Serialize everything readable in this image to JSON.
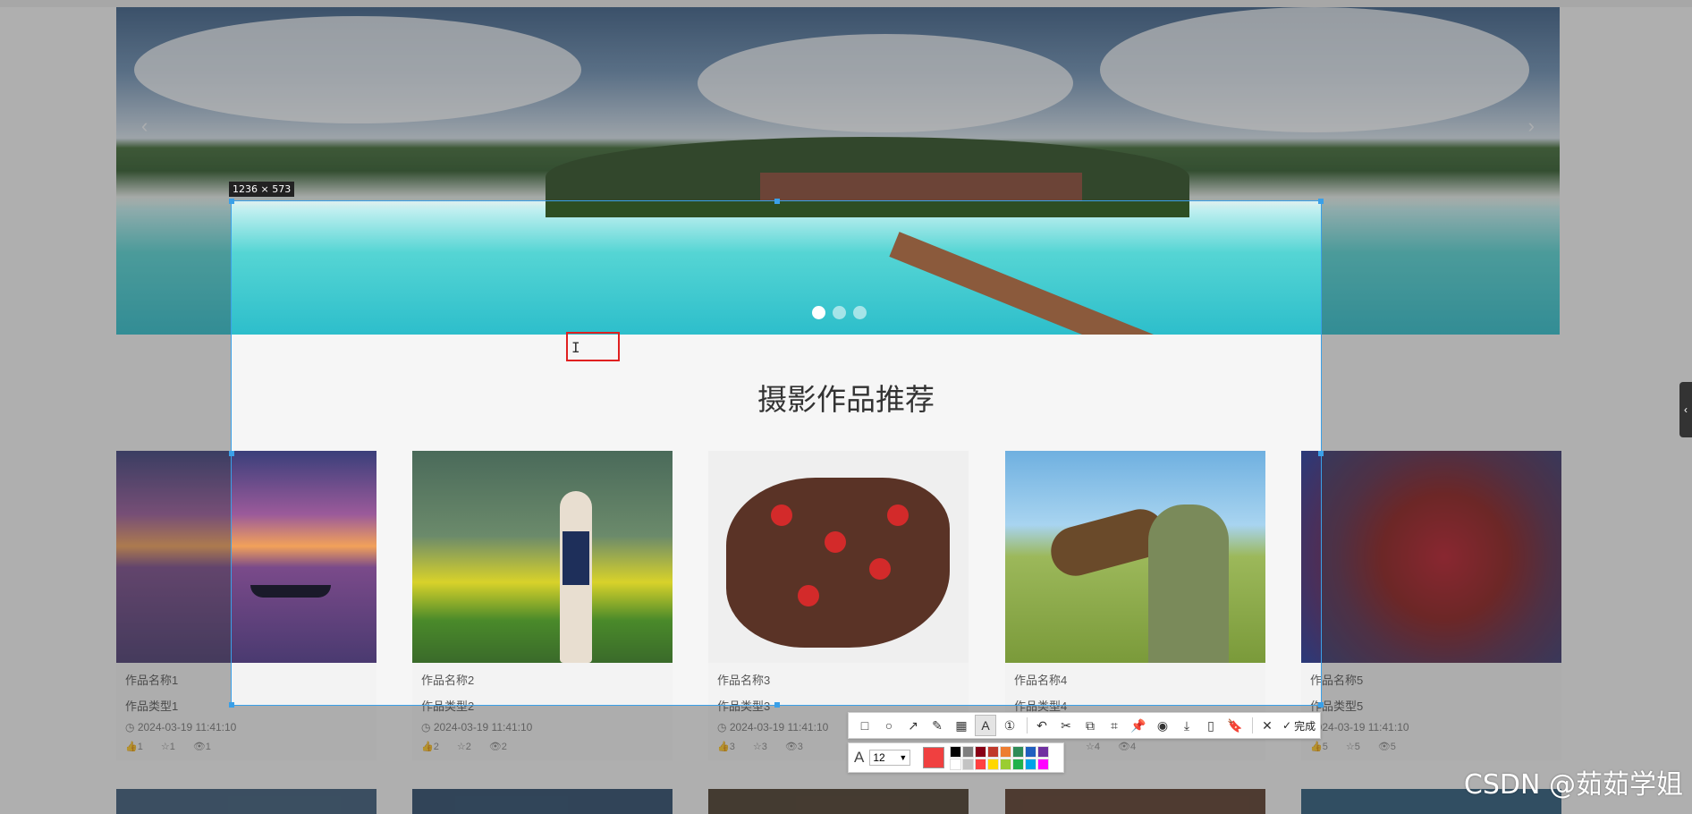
{
  "capture": {
    "size_label": "1236 × 573"
  },
  "banner": {
    "dots": 3,
    "active_dot": 0,
    "arrow_left": "‹",
    "arrow_right": "›"
  },
  "section": {
    "title": "摄影作品推荐"
  },
  "cards": [
    {
      "name": "作品名称1",
      "type": "作品类型1",
      "time": "2024-03-19 11:41:10",
      "likes": "1",
      "collects": "1",
      "views": "1"
    },
    {
      "name": "作品名称2",
      "type": "作品类型2",
      "time": "2024-03-19 11:41:10",
      "likes": "2",
      "collects": "2",
      "views": "2"
    },
    {
      "name": "作品名称3",
      "type": "作品类型3",
      "time": "2024-03-19 11:41:10",
      "likes": "3",
      "collects": "3",
      "views": "3"
    },
    {
      "name": "作品名称4",
      "type": "作品类型4",
      "time": "",
      "likes": "",
      "collects": "4",
      "views": "4"
    },
    {
      "name": "作品名称5",
      "type": "作品类型5",
      "time": "2024-03-19 11:41:10",
      "likes": "5",
      "collects": "5",
      "views": "5"
    }
  ],
  "toolbar": {
    "tools": [
      "rectangle-icon",
      "ellipse-icon",
      "arrow-icon",
      "pencil-icon",
      "mosaic-icon",
      "text-icon",
      "number-icon",
      "undo-icon",
      "cut-icon",
      "translate-icon",
      "ocr-icon",
      "pin-icon",
      "record-icon",
      "download-icon",
      "long-screenshot-icon",
      "bookmark-icon"
    ],
    "done_label": "完成",
    "font_size": "12",
    "current_color": "#f04040",
    "palette": [
      "#000000",
      "#7f7f7f",
      "#880015",
      "#c0392b",
      "#ed7d31",
      "#2e8b57",
      "#1f5fbf",
      "#7030a0",
      "#ffffff",
      "#c3c3c3",
      "#ff4040",
      "#ffd700",
      "#9acd32",
      "#22b14c",
      "#00a2e8",
      "#ff00ff"
    ]
  },
  "watermark": "CSDN @茹茹学姐",
  "side_tab": "‹"
}
